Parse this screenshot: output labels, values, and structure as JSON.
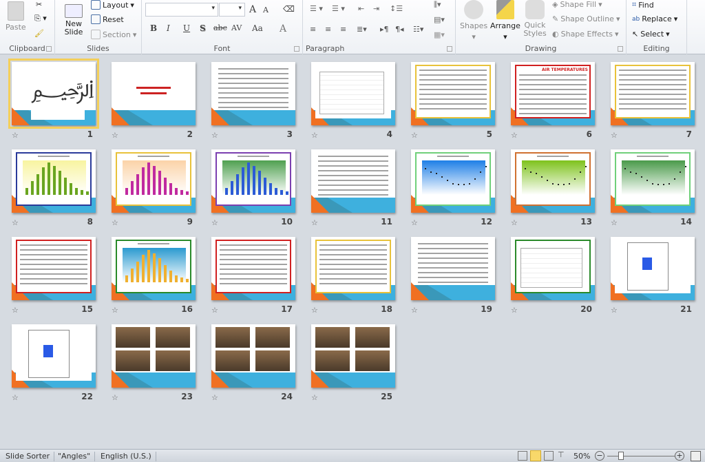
{
  "ribbon": {
    "clipboard": {
      "label": "Clipboard",
      "paste": "Paste"
    },
    "slides": {
      "label": "Slides",
      "new_slide": "New Slide",
      "layout": "Layout",
      "reset": "Reset",
      "section": "Section"
    },
    "font": {
      "label": "Font",
      "font_name": "",
      "font_size": "",
      "bold": "B",
      "italic": "I",
      "underline": "U",
      "shadow": "S",
      "strike": "abc",
      "spacing": "AV",
      "case": "Aa",
      "color": "A",
      "grow": "A",
      "shrink": "A"
    },
    "paragraph": {
      "label": "Paragraph"
    },
    "drawing": {
      "label": "Drawing",
      "shapes": "Shapes",
      "arrange": "Arrange",
      "quick_styles": "Quick Styles",
      "shape_fill": "Shape Fill",
      "shape_outline": "Shape Outline",
      "shape_effects": "Shape Effects"
    },
    "editing": {
      "label": "Editing",
      "find": "Find",
      "replace": "Replace",
      "select": "Select"
    }
  },
  "slides": [
    {
      "n": "1",
      "kind": "calligraphy",
      "selected": true
    },
    {
      "n": "2",
      "kind": "title"
    },
    {
      "n": "3",
      "kind": "text"
    },
    {
      "n": "4",
      "kind": "map"
    },
    {
      "n": "5",
      "kind": "text",
      "border": "#e8c23a"
    },
    {
      "n": "6",
      "kind": "text",
      "border": "#d02020",
      "title": "AIR TEMPERATURES"
    },
    {
      "n": "7",
      "kind": "text",
      "border": "#e8c23a"
    },
    {
      "n": "8",
      "kind": "bar",
      "bg": "#f8f4a0",
      "bars": "#6aa520",
      "border": "#2a3a9a"
    },
    {
      "n": "9",
      "kind": "bar",
      "bg": "#fbd3a8",
      "bars": "#c02aa0",
      "border": "#e8c23a"
    },
    {
      "n": "10",
      "kind": "bar",
      "bg": "#4fa050",
      "bars": "#2c5bd6",
      "border": "#7b3fb0"
    },
    {
      "n": "11",
      "kind": "text"
    },
    {
      "n": "12",
      "kind": "line",
      "bg": "#1e7fe6",
      "border": "#6fd07a"
    },
    {
      "n": "13",
      "kind": "line",
      "bg": "#7ec21c",
      "border": "#d07030"
    },
    {
      "n": "14",
      "kind": "line",
      "bg": "#4a9a4a",
      "border": "#6fd07a"
    },
    {
      "n": "15",
      "kind": "text",
      "border": "#d02020"
    },
    {
      "n": "16",
      "kind": "bar",
      "bg": "#2a9ad0",
      "bars": "#f0b030",
      "border": "#2a8a2a"
    },
    {
      "n": "17",
      "kind": "text",
      "border": "#d02020"
    },
    {
      "n": "18",
      "kind": "text",
      "border": "#e8c23a"
    },
    {
      "n": "19",
      "kind": "text"
    },
    {
      "n": "20",
      "kind": "map",
      "border": "#2a8a2a"
    },
    {
      "n": "21",
      "kind": "plan"
    },
    {
      "n": "22",
      "kind": "plan"
    },
    {
      "n": "23",
      "kind": "photos"
    },
    {
      "n": "24",
      "kind": "photos"
    },
    {
      "n": "25",
      "kind": "photos"
    }
  ],
  "status": {
    "view": "Slide Sorter",
    "theme": "\"Angles\"",
    "language": "English (U.S.)",
    "zoom": "50%",
    "zoom_level": 50
  },
  "colors": {
    "accent_orange": "#f07022",
    "accent_blue": "#3eb0de",
    "selection": "#f3cf5a"
  }
}
